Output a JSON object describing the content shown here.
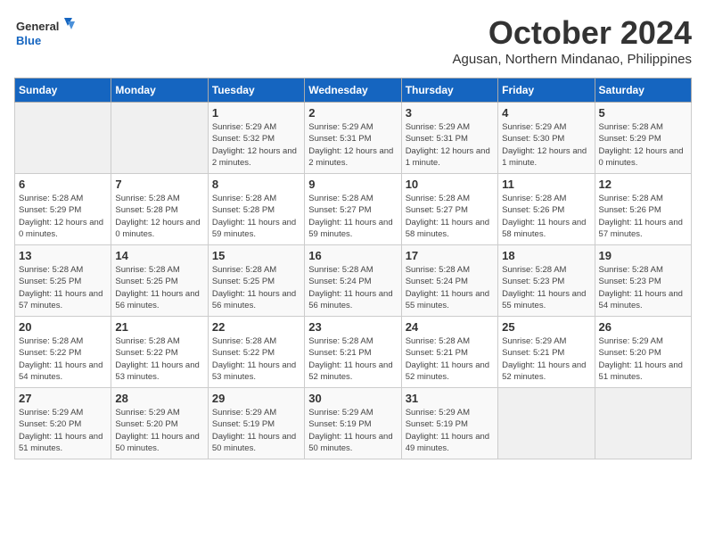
{
  "logo": {
    "text_general": "General",
    "text_blue": "Blue"
  },
  "title": "October 2024",
  "subtitle": "Agusan, Northern Mindanao, Philippines",
  "days_of_week": [
    "Sunday",
    "Monday",
    "Tuesday",
    "Wednesday",
    "Thursday",
    "Friday",
    "Saturday"
  ],
  "weeks": [
    [
      {
        "day": "",
        "info": ""
      },
      {
        "day": "",
        "info": ""
      },
      {
        "day": "1",
        "info": "Sunrise: 5:29 AM\nSunset: 5:32 PM\nDaylight: 12 hours and 2 minutes."
      },
      {
        "day": "2",
        "info": "Sunrise: 5:29 AM\nSunset: 5:31 PM\nDaylight: 12 hours and 2 minutes."
      },
      {
        "day": "3",
        "info": "Sunrise: 5:29 AM\nSunset: 5:31 PM\nDaylight: 12 hours and 1 minute."
      },
      {
        "day": "4",
        "info": "Sunrise: 5:29 AM\nSunset: 5:30 PM\nDaylight: 12 hours and 1 minute."
      },
      {
        "day": "5",
        "info": "Sunrise: 5:28 AM\nSunset: 5:29 PM\nDaylight: 12 hours and 0 minutes."
      }
    ],
    [
      {
        "day": "6",
        "info": "Sunrise: 5:28 AM\nSunset: 5:29 PM\nDaylight: 12 hours and 0 minutes."
      },
      {
        "day": "7",
        "info": "Sunrise: 5:28 AM\nSunset: 5:28 PM\nDaylight: 12 hours and 0 minutes."
      },
      {
        "day": "8",
        "info": "Sunrise: 5:28 AM\nSunset: 5:28 PM\nDaylight: 11 hours and 59 minutes."
      },
      {
        "day": "9",
        "info": "Sunrise: 5:28 AM\nSunset: 5:27 PM\nDaylight: 11 hours and 59 minutes."
      },
      {
        "day": "10",
        "info": "Sunrise: 5:28 AM\nSunset: 5:27 PM\nDaylight: 11 hours and 58 minutes."
      },
      {
        "day": "11",
        "info": "Sunrise: 5:28 AM\nSunset: 5:26 PM\nDaylight: 11 hours and 58 minutes."
      },
      {
        "day": "12",
        "info": "Sunrise: 5:28 AM\nSunset: 5:26 PM\nDaylight: 11 hours and 57 minutes."
      }
    ],
    [
      {
        "day": "13",
        "info": "Sunrise: 5:28 AM\nSunset: 5:25 PM\nDaylight: 11 hours and 57 minutes."
      },
      {
        "day": "14",
        "info": "Sunrise: 5:28 AM\nSunset: 5:25 PM\nDaylight: 11 hours and 56 minutes."
      },
      {
        "day": "15",
        "info": "Sunrise: 5:28 AM\nSunset: 5:25 PM\nDaylight: 11 hours and 56 minutes."
      },
      {
        "day": "16",
        "info": "Sunrise: 5:28 AM\nSunset: 5:24 PM\nDaylight: 11 hours and 56 minutes."
      },
      {
        "day": "17",
        "info": "Sunrise: 5:28 AM\nSunset: 5:24 PM\nDaylight: 11 hours and 55 minutes."
      },
      {
        "day": "18",
        "info": "Sunrise: 5:28 AM\nSunset: 5:23 PM\nDaylight: 11 hours and 55 minutes."
      },
      {
        "day": "19",
        "info": "Sunrise: 5:28 AM\nSunset: 5:23 PM\nDaylight: 11 hours and 54 minutes."
      }
    ],
    [
      {
        "day": "20",
        "info": "Sunrise: 5:28 AM\nSunset: 5:22 PM\nDaylight: 11 hours and 54 minutes."
      },
      {
        "day": "21",
        "info": "Sunrise: 5:28 AM\nSunset: 5:22 PM\nDaylight: 11 hours and 53 minutes."
      },
      {
        "day": "22",
        "info": "Sunrise: 5:28 AM\nSunset: 5:22 PM\nDaylight: 11 hours and 53 minutes."
      },
      {
        "day": "23",
        "info": "Sunrise: 5:28 AM\nSunset: 5:21 PM\nDaylight: 11 hours and 52 minutes."
      },
      {
        "day": "24",
        "info": "Sunrise: 5:28 AM\nSunset: 5:21 PM\nDaylight: 11 hours and 52 minutes."
      },
      {
        "day": "25",
        "info": "Sunrise: 5:29 AM\nSunset: 5:21 PM\nDaylight: 11 hours and 52 minutes."
      },
      {
        "day": "26",
        "info": "Sunrise: 5:29 AM\nSunset: 5:20 PM\nDaylight: 11 hours and 51 minutes."
      }
    ],
    [
      {
        "day": "27",
        "info": "Sunrise: 5:29 AM\nSunset: 5:20 PM\nDaylight: 11 hours and 51 minutes."
      },
      {
        "day": "28",
        "info": "Sunrise: 5:29 AM\nSunset: 5:20 PM\nDaylight: 11 hours and 50 minutes."
      },
      {
        "day": "29",
        "info": "Sunrise: 5:29 AM\nSunset: 5:19 PM\nDaylight: 11 hours and 50 minutes."
      },
      {
        "day": "30",
        "info": "Sunrise: 5:29 AM\nSunset: 5:19 PM\nDaylight: 11 hours and 50 minutes."
      },
      {
        "day": "31",
        "info": "Sunrise: 5:29 AM\nSunset: 5:19 PM\nDaylight: 11 hours and 49 minutes."
      },
      {
        "day": "",
        "info": ""
      },
      {
        "day": "",
        "info": ""
      }
    ]
  ]
}
